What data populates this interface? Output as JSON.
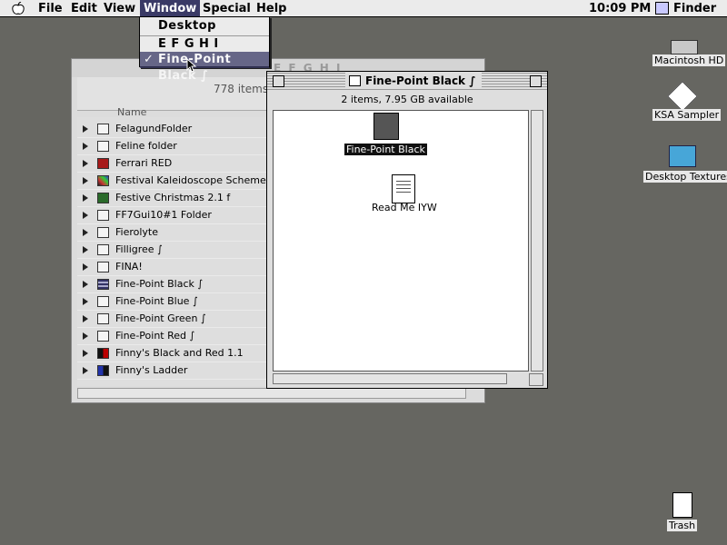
{
  "menubar": {
    "items": [
      "File",
      "Edit",
      "View",
      "Window",
      "Special",
      "Help"
    ],
    "clock": "10:09 PM",
    "app": "Finder"
  },
  "window_menu": {
    "items": [
      "Desktop",
      "E F G H I",
      "Fine-Point Black ∫"
    ],
    "checked": "✓"
  },
  "back_window": {
    "title": "E F G H I",
    "count": "778 items,",
    "column_name": "Name",
    "rows": [
      "FelagundFolder",
      "Feline folder",
      "Ferrari RED",
      "Festival Kaleidoscope Scheme",
      "Festive Christmas 2.1 f",
      "FF7Gui10#1 Folder",
      "Fierolyte",
      "Filligree ∫",
      "FINA!",
      "Fine-Point Black ∫",
      "Fine-Point Blue ∫",
      "Fine-Point Green ∫",
      "Fine-Point Red ∫",
      "Finny's Black and Red 1.1",
      "Finny's Ladder"
    ]
  },
  "front_window": {
    "title": "Fine-Point Black ∫",
    "info": "2 items, 7.95 GB available",
    "items": [
      "Fine-Point Black",
      "Read Me IYW"
    ]
  },
  "desktop": {
    "icons": [
      "Macintosh HD",
      "KSA Sampler",
      "Desktop Textures",
      "Trash"
    ]
  },
  "colors": {
    "desktop": "#666661",
    "highlight": "#3a3a66"
  }
}
